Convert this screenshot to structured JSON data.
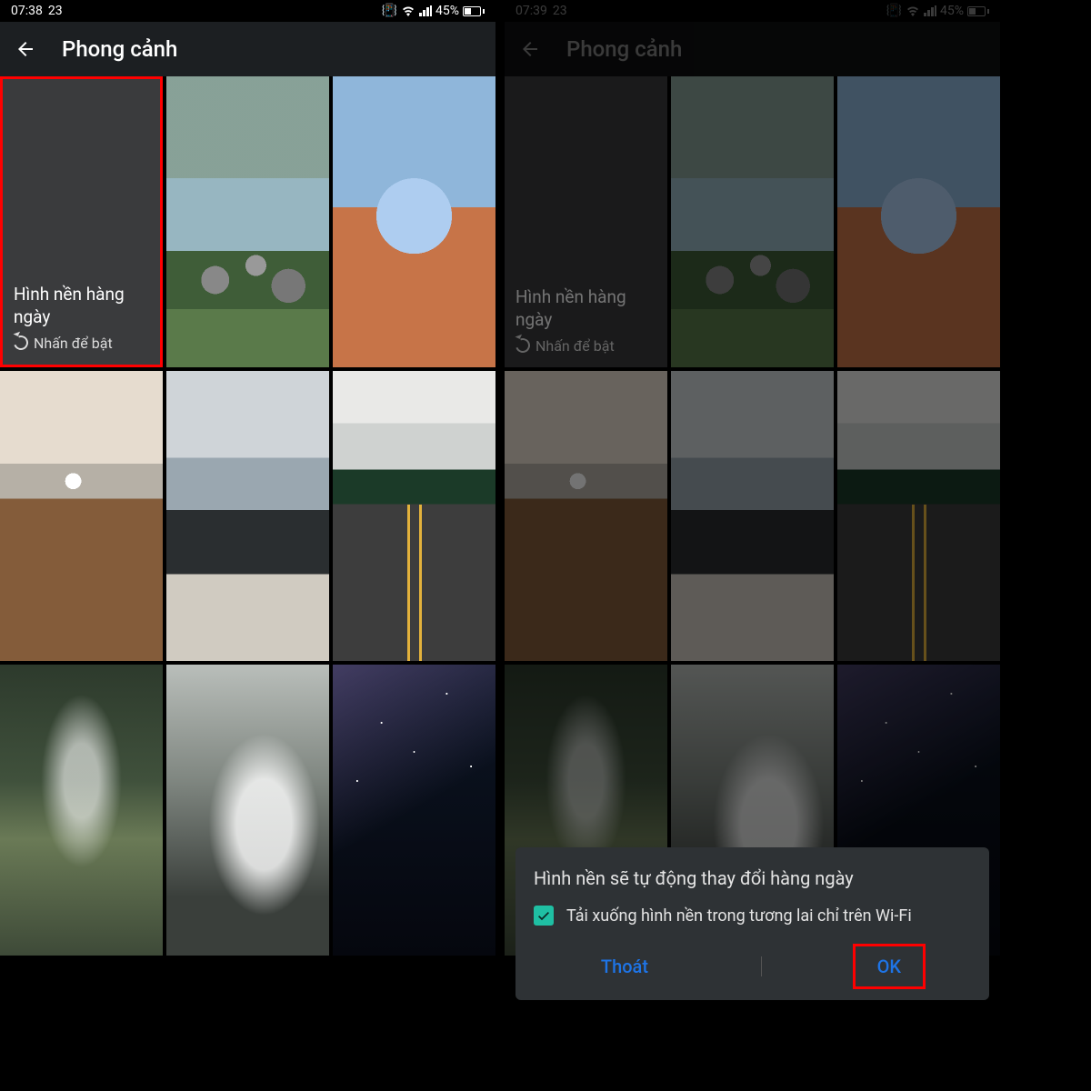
{
  "left": {
    "status": {
      "time": "07:38",
      "date": "23",
      "battery": "45%"
    },
    "title": "Phong cảnh",
    "daily": {
      "title": "Hình nền hàng ngày",
      "sub": "Nhấn để bật"
    }
  },
  "right": {
    "status": {
      "time": "07:39",
      "date": "23",
      "battery": "45%"
    },
    "title": "Phong cảnh",
    "daily": {
      "title": "Hình nền hàng ngày",
      "sub": "Nhấn để bật"
    },
    "dialog": {
      "title": "Hình nền sẽ tự động thay đổi hàng ngày",
      "check_text": "Tải xuống hình nền trong tương lai chỉ trên Wi-Fi",
      "cancel": "Thoát",
      "ok": "OK"
    }
  }
}
